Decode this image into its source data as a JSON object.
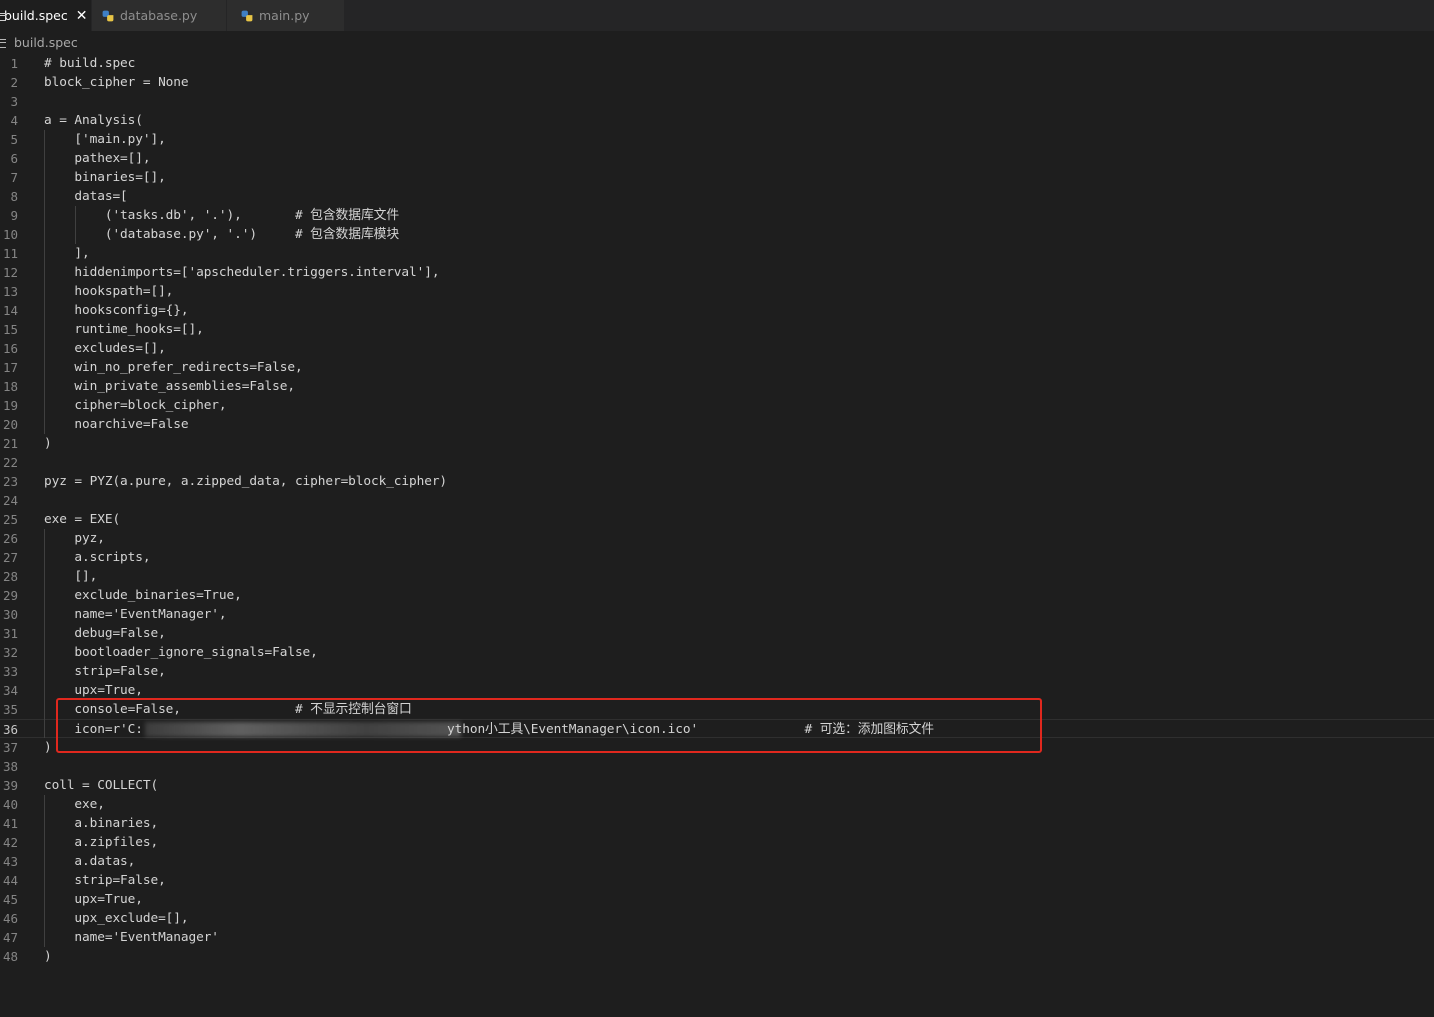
{
  "tabs": [
    {
      "label": "build.spec",
      "icon": "file-lines-icon",
      "active": true,
      "close": "✕"
    },
    {
      "label": "database.py",
      "icon": "python-icon",
      "active": false
    },
    {
      "label": "main.py",
      "icon": "python-icon",
      "active": false
    }
  ],
  "breadcrumb": {
    "file": "build.spec",
    "icon": "file-lines-icon"
  },
  "editor": {
    "current_line": 36,
    "lines": [
      {
        "n": "1",
        "text": "# build.spec"
      },
      {
        "n": "2",
        "text": "block_cipher = None"
      },
      {
        "n": "3",
        "text": ""
      },
      {
        "n": "4",
        "text": "a = Analysis("
      },
      {
        "n": "5",
        "text": "    ['main.py'],"
      },
      {
        "n": "6",
        "text": "    pathex=[],"
      },
      {
        "n": "7",
        "text": "    binaries=[],"
      },
      {
        "n": "8",
        "text": "    datas=["
      },
      {
        "n": "9",
        "text": "        ('tasks.db', '.'),       # 包含数据库文件"
      },
      {
        "n": "10",
        "text": "        ('database.py', '.')     # 包含数据库模块"
      },
      {
        "n": "11",
        "text": "    ],"
      },
      {
        "n": "12",
        "text": "    hiddenimports=['apscheduler.triggers.interval'],"
      },
      {
        "n": "13",
        "text": "    hookspath=[],"
      },
      {
        "n": "14",
        "text": "    hooksconfig={},"
      },
      {
        "n": "15",
        "text": "    runtime_hooks=[],"
      },
      {
        "n": "16",
        "text": "    excludes=[],"
      },
      {
        "n": "17",
        "text": "    win_no_prefer_redirects=False,"
      },
      {
        "n": "18",
        "text": "    win_private_assemblies=False,"
      },
      {
        "n": "19",
        "text": "    cipher=block_cipher,"
      },
      {
        "n": "20",
        "text": "    noarchive=False"
      },
      {
        "n": "21",
        "text": ")"
      },
      {
        "n": "22",
        "text": ""
      },
      {
        "n": "23",
        "text": "pyz = PYZ(a.pure, a.zipped_data, cipher=block_cipher)"
      },
      {
        "n": "24",
        "text": ""
      },
      {
        "n": "25",
        "text": "exe = EXE("
      },
      {
        "n": "26",
        "text": "    pyz,"
      },
      {
        "n": "27",
        "text": "    a.scripts,"
      },
      {
        "n": "28",
        "text": "    [],"
      },
      {
        "n": "29",
        "text": "    exclude_binaries=True,"
      },
      {
        "n": "30",
        "text": "    name='EventManager',"
      },
      {
        "n": "31",
        "text": "    debug=False,"
      },
      {
        "n": "32",
        "text": "    bootloader_ignore_signals=False,"
      },
      {
        "n": "33",
        "text": "    strip=False,"
      },
      {
        "n": "34",
        "text": "    upx=True,"
      },
      {
        "n": "35",
        "text": "    console=False,               # 不显示控制台窗口"
      },
      {
        "n": "36",
        "text": "    icon=r'C:                                        ython小工具\\EventManager\\icon.ico'              # 可选：添加图标文件"
      },
      {
        "n": "37",
        "text": ")"
      },
      {
        "n": "38",
        "text": ""
      },
      {
        "n": "39",
        "text": "coll = COLLECT("
      },
      {
        "n": "40",
        "text": "    exe,"
      },
      {
        "n": "41",
        "text": "    a.binaries,"
      },
      {
        "n": "42",
        "text": "    a.zipfiles,"
      },
      {
        "n": "43",
        "text": "    a.datas,"
      },
      {
        "n": "44",
        "text": "    strip=False,"
      },
      {
        "n": "45",
        "text": "    upx=True,"
      },
      {
        "n": "46",
        "text": "    upx_exclude=[],"
      },
      {
        "n": "47",
        "text": "    name='EventManager'"
      },
      {
        "n": "48",
        "text": ")"
      }
    ]
  },
  "colors": {
    "background": "#1e1e1e",
    "tabbar": "#252526",
    "text": "#d4d4d4",
    "line_number": "#858585",
    "highlight_box": "#e0281e"
  }
}
